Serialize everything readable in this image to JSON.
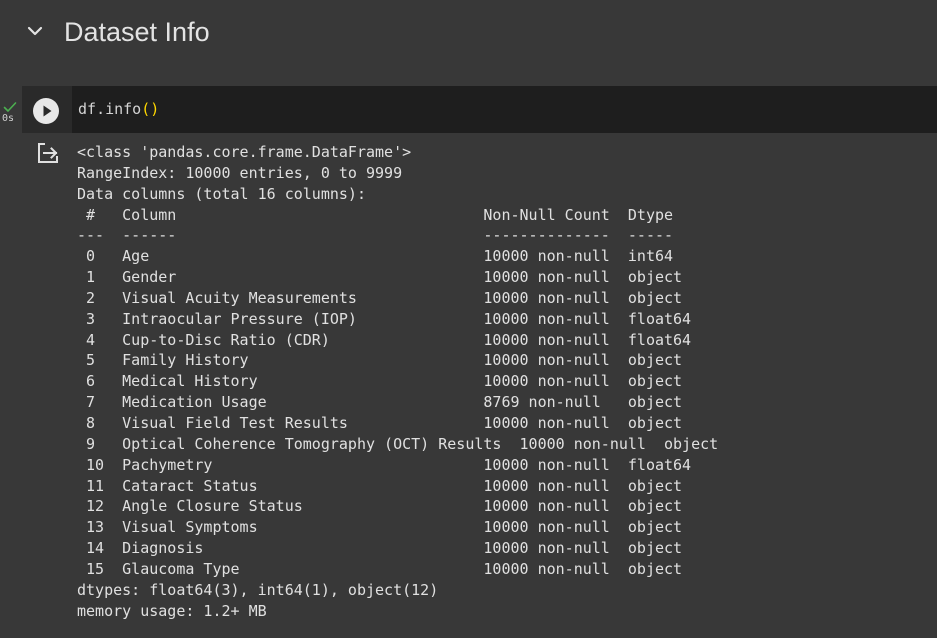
{
  "section": {
    "title": "Dataset Info",
    "collapse_icon": "chevron-down-icon"
  },
  "cell": {
    "status_icon": "checkmark-icon",
    "exec_time": "0s",
    "run_icon": "play-icon",
    "code": {
      "object": "df",
      "method": ".info",
      "open_paren": "(",
      "close_paren": ")"
    },
    "output_icon": "output-redirect-icon",
    "output": {
      "lines": [
        "<class 'pandas.core.frame.DataFrame'>",
        "RangeIndex: 10000 entries, 0 to 9999",
        "Data columns (total 16 columns):",
        " #   Column                                  Non-Null Count  Dtype  ",
        "---  ------                                  --------------  -----  ",
        " 0   Age                                     10000 non-null  int64  ",
        " 1   Gender                                  10000 non-null  object ",
        " 2   Visual Acuity Measurements              10000 non-null  object ",
        " 3   Intraocular Pressure (IOP)              10000 non-null  float64",
        " 4   Cup-to-Disc Ratio (CDR)                 10000 non-null  float64",
        " 5   Family History                          10000 non-null  object ",
        " 6   Medical History                         10000 non-null  object ",
        " 7   Medication Usage                        8769 non-null   object ",
        " 8   Visual Field Test Results               10000 non-null  object ",
        " 9   Optical Coherence Tomography (OCT) Results  10000 non-null  object ",
        " 10  Pachymetry                              10000 non-null  float64",
        " 11  Cataract Status                         10000 non-null  object ",
        " 12  Angle Closure Status                    10000 non-null  object ",
        " 13  Visual Symptoms                         10000 non-null  object ",
        " 14  Diagnosis                               10000 non-null  object ",
        " 15  Glaucoma Type                           10000 non-null  object ",
        "dtypes: float64(3), int64(1), object(12)",
        "memory usage: 1.2+ MB"
      ]
    }
  },
  "colors": {
    "background": "#383838",
    "code_background": "#1e1e1e",
    "check": "#4caf50",
    "paren": "#ffd700",
    "text": "#e0e0e0"
  }
}
